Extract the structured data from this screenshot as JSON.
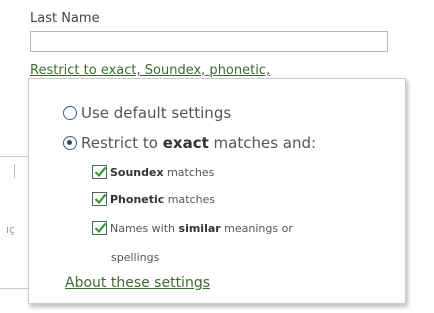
{
  "last_name": {
    "label": "Last Name",
    "value": "",
    "restrict_link": "Restrict to exact, Soundex, phonetic,"
  },
  "background": {
    "left_glyphs": [
      "l",
      "ıç"
    ]
  },
  "popup": {
    "default_option": "Use default settings",
    "restrict_option": {
      "prefix": "Restrict to ",
      "bold": "exact",
      "suffix": " matches and:"
    },
    "soundex": {
      "bold": "Soundex",
      "suffix": " matches",
      "checked": true
    },
    "phonetic": {
      "bold": "Phonetic",
      "suffix": " matches",
      "checked": true
    },
    "similar": {
      "prefix": "Names with ",
      "bold": "similar",
      "suffix": " meanings or",
      "continuation": "spellings",
      "checked": true
    },
    "about_link": "About these settings"
  },
  "colors": {
    "link": "#3d6b2f",
    "check_mark": "#3a9a3a",
    "radio": "#2d4b72"
  }
}
